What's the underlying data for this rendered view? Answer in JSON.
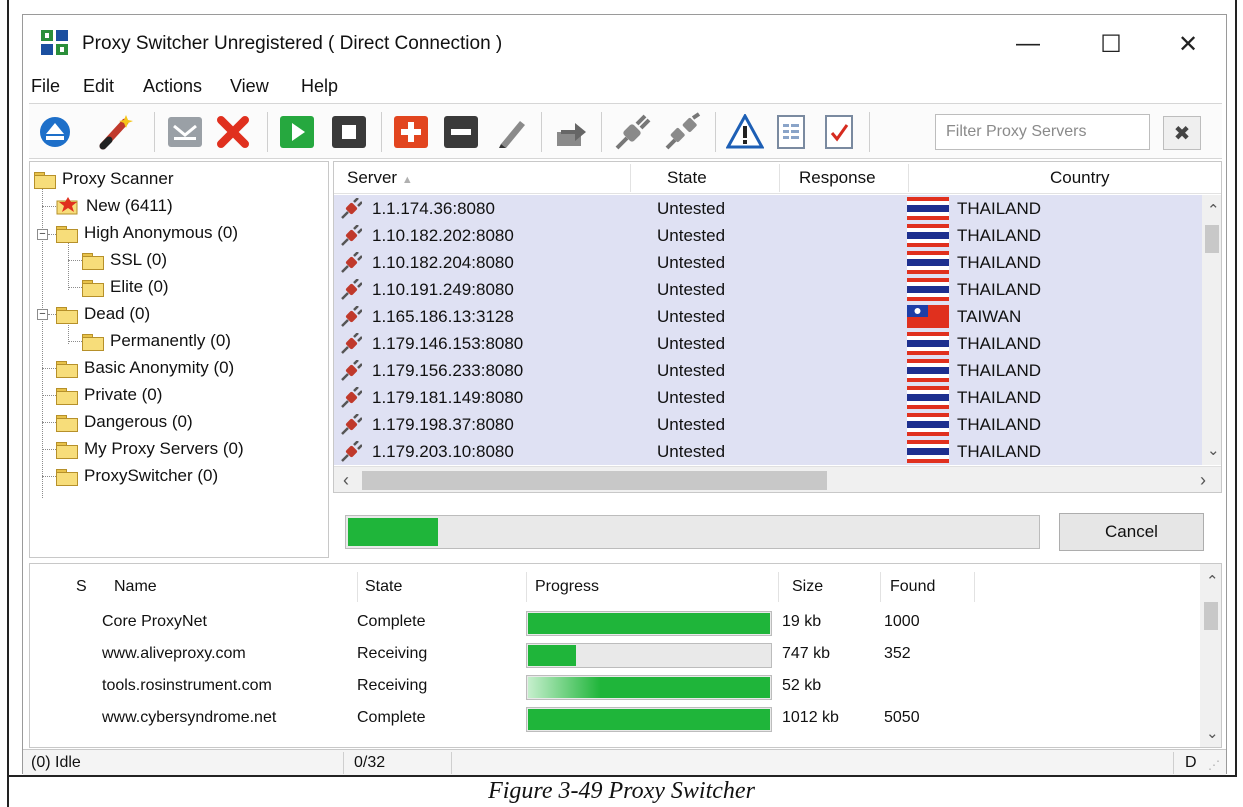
{
  "window": {
    "title": "Proxy Switcher Unregistered ( Direct Connection )",
    "controls": {
      "minimize": "—",
      "maximize": "☐",
      "close": "✕"
    }
  },
  "menu": [
    "File",
    "Edit",
    "Actions",
    "View",
    "Help"
  ],
  "toolbar": {
    "icons": [
      "eject-icon",
      "magic-wand-icon",
      "mail-icon",
      "delete-icon",
      "play-icon",
      "stop-icon",
      "add-icon",
      "remove-icon",
      "edit-icon",
      "export-icon",
      "connect-icon",
      "disconnect-icon",
      "warning-icon",
      "document-icon",
      "checklist-icon"
    ],
    "filter_placeholder": "Filter Proxy Servers",
    "filter_clear_glyph": "✖"
  },
  "tree": {
    "root": "Proxy Scanner",
    "items": [
      {
        "label": "New (6411)"
      },
      {
        "label": "High Anonymous (0)"
      },
      {
        "label": "SSL (0)"
      },
      {
        "label": "Elite (0)"
      },
      {
        "label": "Dead (0)"
      },
      {
        "label": "Permanently (0)"
      },
      {
        "label": "Basic Anonymity (0)"
      },
      {
        "label": "Private (0)"
      },
      {
        "label": "Dangerous (0)"
      },
      {
        "label": "My Proxy Servers (0)"
      },
      {
        "label": "ProxySwitcher (0)"
      }
    ]
  },
  "server_list": {
    "columns": [
      "Server",
      "State",
      "Response",
      "Country"
    ],
    "sort_indicator": "▲",
    "rows": [
      {
        "server": "1.1.174.36:8080",
        "state": "Untested",
        "response": "",
        "country": "THAILAND",
        "flag": "thailand"
      },
      {
        "server": "1.10.182.202:8080",
        "state": "Untested",
        "response": "",
        "country": "THAILAND",
        "flag": "thailand"
      },
      {
        "server": "1.10.182.204:8080",
        "state": "Untested",
        "response": "",
        "country": "THAILAND",
        "flag": "thailand"
      },
      {
        "server": "1.10.191.249:8080",
        "state": "Untested",
        "response": "",
        "country": "THAILAND",
        "flag": "thailand"
      },
      {
        "server": "1.165.186.13:3128",
        "state": "Untested",
        "response": "",
        "country": "TAIWAN",
        "flag": "taiwan"
      },
      {
        "server": "1.179.146.153:8080",
        "state": "Untested",
        "response": "",
        "country": "THAILAND",
        "flag": "thailand"
      },
      {
        "server": "1.179.156.233:8080",
        "state": "Untested",
        "response": "",
        "country": "THAILAND",
        "flag": "thailand"
      },
      {
        "server": "1.179.181.149:8080",
        "state": "Untested",
        "response": "",
        "country": "THAILAND",
        "flag": "thailand"
      },
      {
        "server": "1.179.198.37:8080",
        "state": "Untested",
        "response": "",
        "country": "THAILAND",
        "flag": "thailand"
      },
      {
        "server": "1.179.203.10:8080",
        "state": "Untested",
        "response": "",
        "country": "THAILAND",
        "flag": "thailand"
      }
    ]
  },
  "scan": {
    "progress": 0.13,
    "cancel_label": "Cancel"
  },
  "sources": {
    "columns": [
      "S",
      "Name",
      "State",
      "Progress",
      "Size",
      "Found"
    ],
    "rows": [
      {
        "name": "Core ProxyNet",
        "state": "Complete",
        "progress": 1.0,
        "indeterminate": false,
        "size": "19 kb",
        "found": "1000"
      },
      {
        "name": "www.aliveproxy.com",
        "state": "Receiving",
        "progress": 0.2,
        "indeterminate": false,
        "size": "747 kb",
        "found": "352"
      },
      {
        "name": "tools.rosinstrument.com",
        "state": "Receiving",
        "progress": 1.0,
        "indeterminate": true,
        "size": "52 kb",
        "found": ""
      },
      {
        "name": "www.cybersyndrome.net",
        "state": "Complete",
        "progress": 1.0,
        "indeterminate": false,
        "size": "1012 kb",
        "found": "5050"
      }
    ]
  },
  "status": {
    "left": "(0) Idle",
    "middle": "0/32",
    "right": "D"
  },
  "caption": "Figure 3-49 Proxy Switcher",
  "colors": {
    "accent_green": "#1fb53a",
    "row_highlight": "#dfe1f3"
  }
}
